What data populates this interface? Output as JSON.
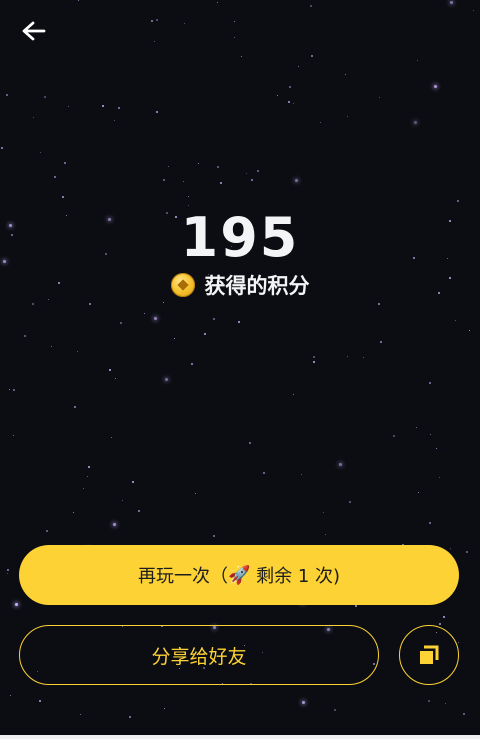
{
  "header": {
    "back_icon": "arrow-left-icon"
  },
  "result": {
    "score": "195",
    "label": "获得的积分",
    "coin_icon": "coin-icon"
  },
  "actions": {
    "play_again_prefix": "再玩一次（",
    "rocket_icon": "🚀",
    "play_again_suffix": " 剩余 1 次)",
    "share_label": "分享给好友",
    "copy_icon": "copy-icon"
  },
  "colors": {
    "background": "#0b0d12",
    "accent": "#fdd235",
    "star": "#c9b3ff"
  }
}
